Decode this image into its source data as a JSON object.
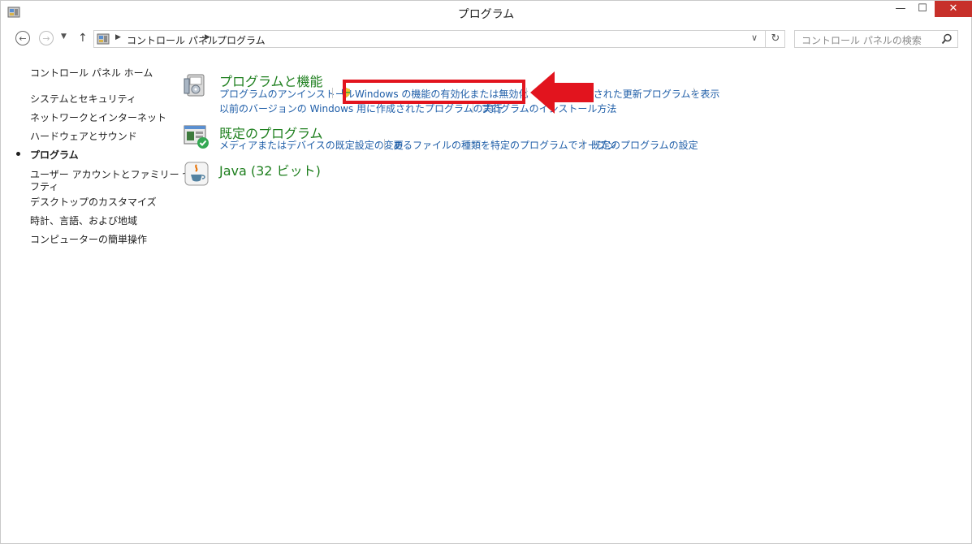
{
  "window": {
    "title": "プログラム",
    "minimize_label": "—",
    "maximize_label": "☐",
    "close_label": "✕"
  },
  "navigation": {
    "back_icon": "←",
    "forward_icon": "→",
    "recent_icon": "▼",
    "up_icon": "↑",
    "breadcrumbs": [
      "コントロール パネル",
      "プログラム"
    ],
    "dropdown_icon": "∨",
    "refresh_icon": "↻",
    "search_placeholder": "コントロール パネルの検索"
  },
  "sidebar": {
    "home": "コントロール パネル ホーム",
    "items": [
      "システムとセキュリティ",
      "ネットワークとインターネット",
      "ハードウェアとサウンド",
      "プログラム",
      "ユーザー アカウントとファミリー セー",
      "フティ",
      "デスクトップのカスタマイズ",
      "時計、言語、および地域",
      "コンピューターの簡単操作"
    ]
  },
  "categories": {
    "programs_features": {
      "title": "プログラムと機能",
      "links": [
        "プログラムのアンインストール",
        "Windows の機能の有効化または無効化",
        "インストールされた更新プログラムを表示",
        "以前のバージョンの Windows 用に作成されたプログラムの実行",
        "プログラムのインストール方法"
      ]
    },
    "default_programs": {
      "title": "既定のプログラム",
      "links": [
        "メディアまたはデバイスの既定設定の変更",
        "あるファイルの種類を特定のプログラムでオープン",
        "既定のプログラムの設定"
      ]
    },
    "java": {
      "title": "Java (32 ビット)"
    }
  },
  "annotation": {
    "highlight_color": "#e2141e",
    "arrow_color": "#e2141e"
  },
  "icons": [
    "control-panel-icon",
    "programs-features-icon",
    "default-programs-icon",
    "java-icon",
    "shield-icon",
    "search-icon"
  ]
}
